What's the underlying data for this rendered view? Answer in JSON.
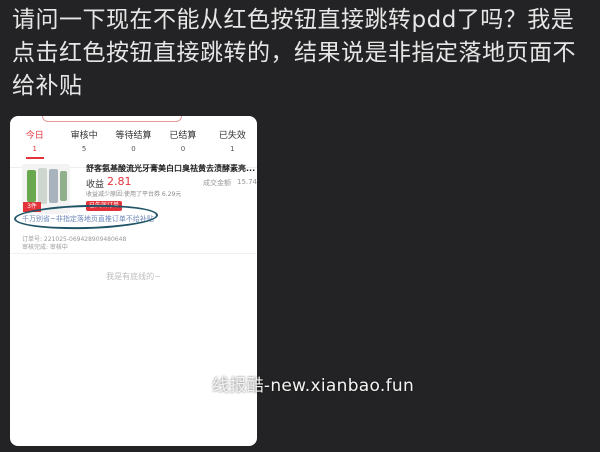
{
  "question": "请问一下现在不能从红色按钮直接跳转pdd了吗？我是点击红色按钮直接跳转的，结果说是非指定落地页面不给补贴",
  "tabs": [
    {
      "label": "今日",
      "count": "1"
    },
    {
      "label": "审核中",
      "count": "5"
    },
    {
      "label": "等待结算",
      "count": "0"
    },
    {
      "label": "已结算",
      "count": "0"
    },
    {
      "label": "已失效",
      "count": "1"
    }
  ],
  "order": {
    "title": "舒客氨基酸流光牙膏美白口臭祛黄去渍酵素亮...",
    "income_label": "收益",
    "income_value": "2.81",
    "deal_label": "成交金额",
    "deal_value": "15.74",
    "reason": "收益减少原因:使用了平台券 6.29元",
    "status_tag": "已失效订单",
    "thumb_badge": "3件",
    "warning": "千万别省~非指定落地页直推订单不给补贴",
    "order_no": "订单号: 221025-069428909480648",
    "audit": "审核完成: 审核中"
  },
  "bottom_note": "我是有底线的~",
  "watermark": "线报酷-new.xianbao.fun",
  "colors": {
    "accent": "#e2333a",
    "background": "#232325",
    "ellipse": "#1f5566"
  }
}
